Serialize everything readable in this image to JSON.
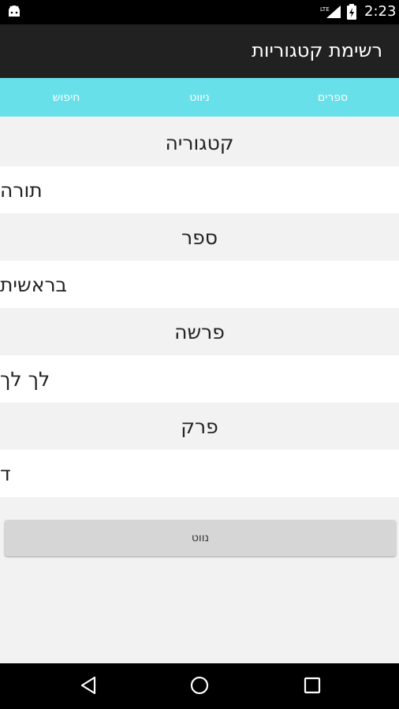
{
  "status_bar": {
    "time": "2:23",
    "network_label": "LTE",
    "icons": [
      "android-icon",
      "lte-signal-icon",
      "battery-icon"
    ]
  },
  "app_bar": {
    "title": "רשימת קטגוריות"
  },
  "tabs": [
    {
      "label": "חיפוש"
    },
    {
      "label": "ניווט"
    },
    {
      "label": "ספרים"
    }
  ],
  "rows": [
    {
      "kind": "header",
      "text": "קטגוריה"
    },
    {
      "kind": "value",
      "text": "תורה"
    },
    {
      "kind": "header",
      "text": "ספר"
    },
    {
      "kind": "value",
      "text": "בראשית"
    },
    {
      "kind": "header",
      "text": "פרשה"
    },
    {
      "kind": "value",
      "text": "לך לך"
    },
    {
      "kind": "header",
      "text": "פרק"
    },
    {
      "kind": "value",
      "text": "ד"
    }
  ],
  "action_button": {
    "label": "נווט"
  },
  "nav_bar": {
    "icons": [
      "back-icon",
      "home-icon",
      "recent-apps-icon"
    ]
  },
  "colors": {
    "tab_bar": "#67e0ea",
    "app_bar": "#212121",
    "status_bar": "#000000",
    "header_row": "#f2f2f2",
    "value_row": "#ffffff",
    "button": "#d6d6d6"
  }
}
